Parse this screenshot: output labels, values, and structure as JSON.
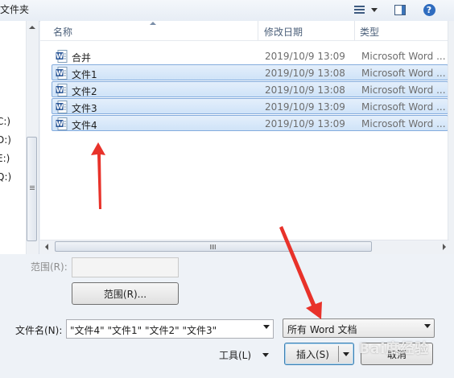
{
  "window": {
    "breadcrumb_tail": "文件夹"
  },
  "nav": {
    "drives": [
      "C:)",
      "D:)",
      "E:)",
      "Q:)"
    ]
  },
  "filelist": {
    "columns": [
      "名称",
      "修改日期",
      "类型"
    ],
    "rows": [
      {
        "name": "合并",
        "date": "2019/10/9 13:09",
        "type": "Microsoft Word ...",
        "selected": false
      },
      {
        "name": "文件1",
        "date": "2019/10/9 13:08",
        "type": "Microsoft Word ...",
        "selected": true
      },
      {
        "name": "文件2",
        "date": "2019/10/9 13:08",
        "type": "Microsoft Word ...",
        "selected": true
      },
      {
        "name": "文件3",
        "date": "2019/10/9 13:09",
        "type": "Microsoft Word ...",
        "selected": true
      },
      {
        "name": "文件4",
        "date": "2019/10/9 13:09",
        "type": "Microsoft Word ...",
        "selected": true
      }
    ]
  },
  "bottom": {
    "range_label": "范围(R):",
    "range_value": "",
    "range_button": "范围(R)...",
    "filename_label": "文件名(N):",
    "filename_value": "\"文件4\" \"文件1\" \"文件2\" \"文件3\"",
    "filetype_value": "所有 Word 文档",
    "tools_label": "工具(L)",
    "insert_button": "插入(S)",
    "cancel_button": "取消"
  },
  "watermark": "Bai度经验",
  "colors": {
    "selection": "#cfe3f8",
    "selection_border": "#84acdd",
    "annotation_arrow": "#e8322a",
    "word_icon": "#2b5797"
  }
}
